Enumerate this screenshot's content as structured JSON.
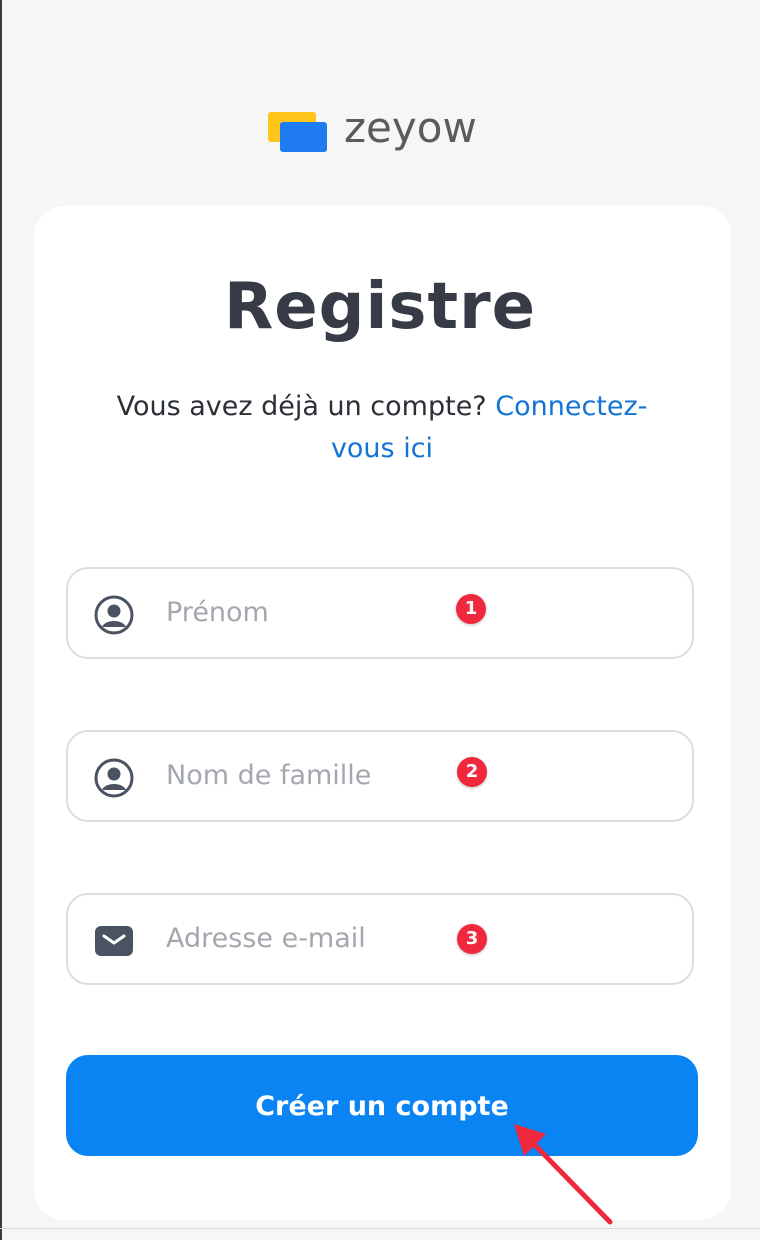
{
  "brand": {
    "name": "zeyow",
    "colors": {
      "yellow": "#ffc51a",
      "blue": "#1e7bf0",
      "text": "#5b5b5f"
    }
  },
  "page": {
    "title": "Registre",
    "subtitle_text": "Vous avez déjà un compte?",
    "login_link_line1": "Connectez-",
    "login_link_line2": "vous ici"
  },
  "form": {
    "first_name": {
      "placeholder": "Prénom",
      "icon": "user-circle-icon",
      "badge": "1"
    },
    "last_name": {
      "placeholder": "Nom de famille",
      "icon": "user-circle-icon",
      "badge": "2"
    },
    "email": {
      "placeholder": "Adresse e-mail",
      "icon": "envelope-icon",
      "badge": "3"
    },
    "submit_label": "Créer un compte"
  },
  "colors": {
    "accent": "#0a84f2",
    "link": "#1474d4",
    "badge": "#f0283d",
    "title": "#363b45"
  }
}
